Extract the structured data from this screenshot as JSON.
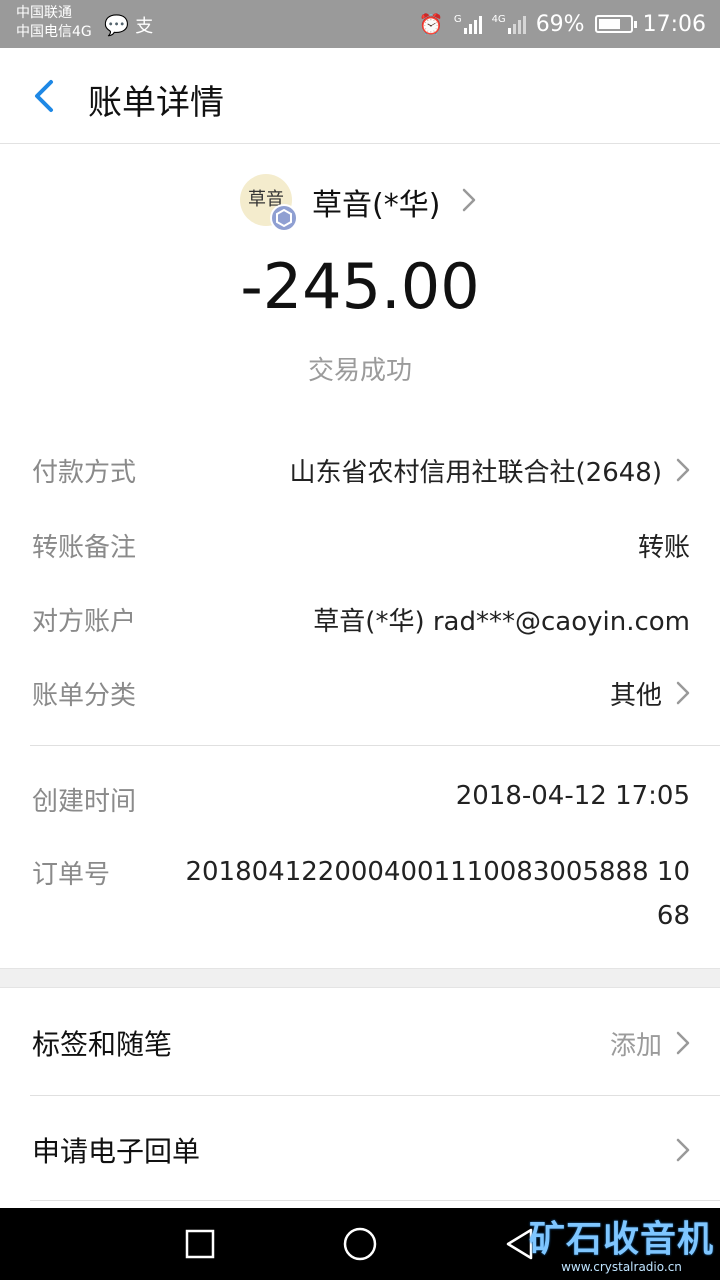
{
  "status_bar": {
    "carrier1": "中国联通",
    "carrier2": "中国电信4G",
    "battery": "69%",
    "time": "17:06",
    "net1": "G",
    "net2": "4G",
    "icons": [
      "message-icon",
      "alipay-icon",
      "alarm-icon",
      "signal-icon",
      "battery-icon"
    ]
  },
  "nav": {
    "title": "账单详情"
  },
  "payee": {
    "name": "草音(*华)",
    "avatar_text": "草音"
  },
  "amount": "-245.00",
  "status": "交易成功",
  "details": {
    "payment_method": {
      "label": "付款方式",
      "value": "山东省农村信用社联合社(2648)"
    },
    "remark": {
      "label": "转账备注",
      "value": "转账"
    },
    "counterparty": {
      "label": "对方账户",
      "value": "草音(*华) rad***@caoyin.com"
    },
    "category": {
      "label": "账单分类",
      "value": "其他"
    },
    "created": {
      "label": "创建时间",
      "value": "2018-04-12 17:05"
    },
    "order_no": {
      "label": "订单号",
      "value": "2018041220004001110083005888 1068"
    }
  },
  "actions": {
    "tags": {
      "label": "标签和随笔",
      "value": "添加"
    },
    "receipt": {
      "label": "申请电子回单"
    }
  },
  "watermark": {
    "title": "矿石收音机",
    "url": "www.crystalradio.cn"
  },
  "colors": {
    "accent": "#1e88e5",
    "status_bar": "#9a9a9a",
    "muted": "#9b9b9b"
  }
}
